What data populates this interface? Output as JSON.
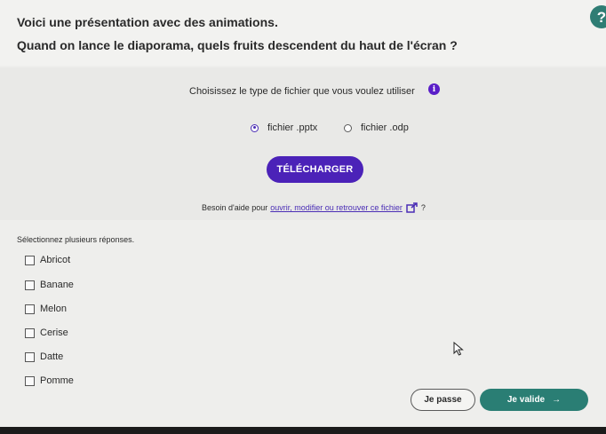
{
  "header": {
    "instruction": "Voici une présentation avec des animations.",
    "question": "Quand on lance le diaporama, quels fruits descendent du haut de l'écran ?",
    "help_icon": "question-mark-icon"
  },
  "download": {
    "prompt": "Choisissez le type de fichier que vous voulez utiliser",
    "info_icon": "info-icon",
    "options": [
      {
        "label": "fichier .pptx",
        "selected": true
      },
      {
        "label": "fichier .odp",
        "selected": false
      }
    ],
    "button_label": "TÉLÉCHARGER",
    "help_prefix": "Besoin d'aide pour",
    "help_link": "ouvrir, modifier ou retrouver ce fichier",
    "help_suffix": "?"
  },
  "quiz": {
    "instruction": "Sélectionnez plusieurs réponses.",
    "choices": [
      "Abricot",
      "Banane",
      "Melon",
      "Cerise",
      "Datte",
      "Pomme"
    ]
  },
  "footer": {
    "skip_label": "Je passe",
    "validate_label": "Je valide",
    "validate_icon": "arrow-right-icon"
  },
  "colors": {
    "accent_purple": "#4b22b8",
    "accent_teal": "#2a7e74"
  }
}
